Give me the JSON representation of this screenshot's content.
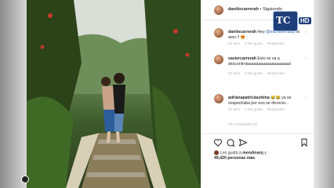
{
  "header": {
    "username": "danilocarrerah",
    "separator": " • ",
    "follow_label": "Siguiendo"
  },
  "logo": {
    "text": "TC",
    "hd": "HD"
  },
  "comments": [
    {
      "user": "danilocarrerah",
      "text_a": " Hey ",
      "mention": "@michellemaud",
      "text_b": " te amo !! ",
      "emoji": "😍",
      "time": "24 sem",
      "likes": "4 Me gusta",
      "reply": "Responder"
    },
    {
      "user": "xaviercarrerah",
      "text_a": " Esto se va a descontrolaaaaaaaaaaaaaaaaaaa!",
      "time": "24 sem",
      "likes": "1 Me gusta",
      "reply": "Responder"
    },
    {
      "user": "adrianapatriciaurbina",
      "text_a": " ",
      "emoji": "😂😂",
      "text_b": " ya se sospechaba por eso se divorcio...",
      "time": "24 sem",
      "likes": "1 Me gusta",
      "reply": "Responder",
      "view_replies": "Ver respuestas (1)"
    }
  ],
  "likes": {
    "prefix": "Les gusta a ",
    "user": "mendinarq",
    "suffix": " y",
    "count": "49,420 personas más"
  },
  "icons": [
    "heart-icon",
    "comment-icon",
    "share-icon",
    "bookmark-icon"
  ]
}
